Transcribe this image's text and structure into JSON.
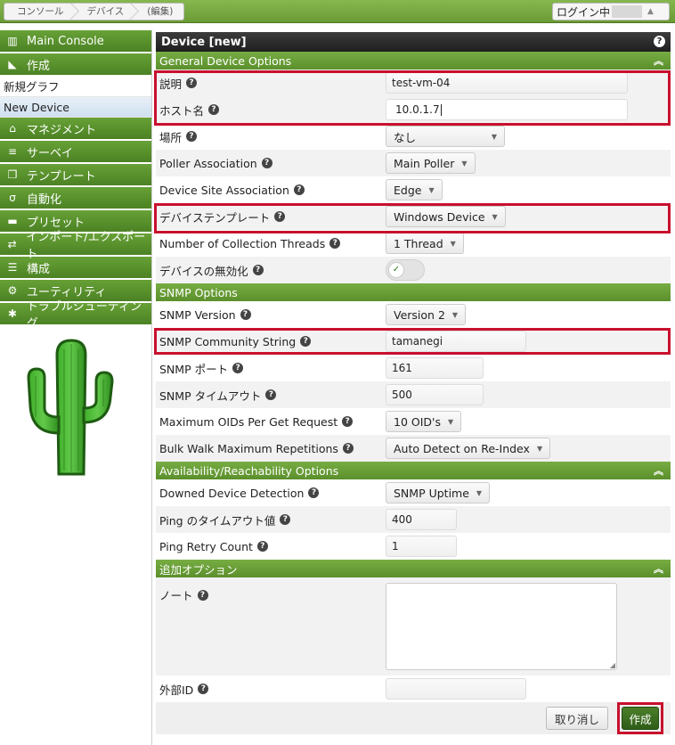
{
  "breadcrumbs": [
    "コンソール",
    "デバイス",
    "(編集)"
  ],
  "login": {
    "label": "ログイン中"
  },
  "sidebar": {
    "items": [
      {
        "label": "Main Console",
        "icon": "map-icon"
      },
      {
        "label": "作成",
        "icon": "chart-icon"
      },
      {
        "label": "新規グラフ",
        "sub": true
      },
      {
        "label": "New Device",
        "sub": true,
        "active": true
      },
      {
        "label": "マネジメント",
        "icon": "home-icon"
      },
      {
        "label": "サーベイ",
        "icon": "database-icon"
      },
      {
        "label": "テンプレート",
        "icon": "copy-icon"
      },
      {
        "label": "自動化",
        "icon": "automation-icon"
      },
      {
        "label": "プリセット",
        "icon": "archive-icon"
      },
      {
        "label": "インポート/エクスポート",
        "icon": "exchange-icon"
      },
      {
        "label": "構成",
        "icon": "sliders-icon"
      },
      {
        "label": "ユーティリティ",
        "icon": "cogs-icon"
      },
      {
        "label": "トラブルシューティング",
        "icon": "bug-icon"
      }
    ]
  },
  "panel": {
    "title": "Device [new]",
    "sections": {
      "general": "General Device Options",
      "snmp": "SNMP Options",
      "availability": "Availability/Reachability Options",
      "additional": "追加オプション"
    },
    "general": {
      "description": {
        "label": "説明",
        "value": "test-vm-04"
      },
      "hostname": {
        "label": "ホスト名",
        "value": "10.0.1.7"
      },
      "location": {
        "label": "場所",
        "value": "なし"
      },
      "poller": {
        "label": "Poller Association",
        "value": "Main Poller"
      },
      "site": {
        "label": "Device Site Association",
        "value": "Edge"
      },
      "template": {
        "label": "デバイステンプレート",
        "value": "Windows Device"
      },
      "threads": {
        "label": "Number of Collection Threads",
        "value": "1 Thread"
      },
      "disable": {
        "label": "デバイスの無効化"
      }
    },
    "snmp": {
      "version": {
        "label": "SNMP Version",
        "value": "Version 2"
      },
      "community": {
        "label": "SNMP Community String",
        "value": "tamanegi"
      },
      "port": {
        "label": "SNMP ポート",
        "value": "161"
      },
      "timeout": {
        "label": "SNMP タイムアウト",
        "value": "500"
      },
      "maxoids": {
        "label": "Maximum OIDs Per Get Request",
        "value": "10 OID's"
      },
      "bulkwalk": {
        "label": "Bulk Walk Maximum Repetitions",
        "value": "Auto Detect on Re-Index"
      }
    },
    "availability": {
      "downed": {
        "label": "Downed Device Detection",
        "value": "SNMP Uptime"
      },
      "pingtimeout": {
        "label": "Ping のタイムアウト値",
        "value": "400"
      },
      "pingretry": {
        "label": "Ping Retry Count",
        "value": "1"
      }
    },
    "additional": {
      "notes": {
        "label": "ノート"
      },
      "externalid": {
        "label": "外部ID"
      }
    },
    "buttons": {
      "cancel": "取り消し",
      "create": "作成"
    }
  },
  "colors": {
    "highlight": "#c8102e",
    "accent": "#5b8f2c"
  }
}
